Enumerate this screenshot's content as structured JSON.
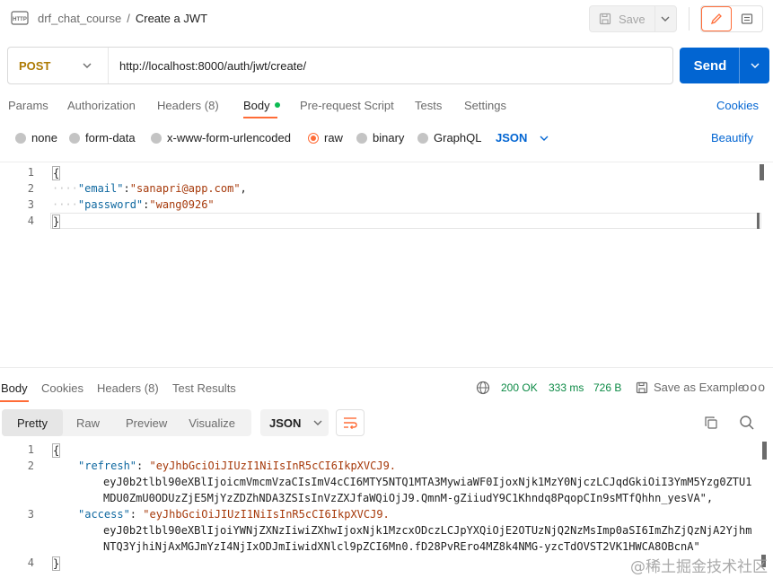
{
  "header": {
    "collection": "drf_chat_course",
    "separator": "/",
    "request_name": "Create a JWT",
    "save_label": "Save"
  },
  "request": {
    "method": "POST",
    "url": "http://localhost:8000/auth/jwt/create/",
    "send_label": "Send"
  },
  "request_tabs": {
    "params": "Params",
    "authorization": "Authorization",
    "headers": "Headers",
    "headers_count": "(8)",
    "body": "Body",
    "pre_request": "Pre-request Script",
    "tests": "Tests",
    "settings": "Settings",
    "cookies": "Cookies"
  },
  "body_types": {
    "none": "none",
    "form_data": "form-data",
    "urlencoded": "x-www-form-urlencoded",
    "raw": "raw",
    "binary": "binary",
    "graphql": "GraphQL",
    "format": "JSON",
    "beautify": "Beautify",
    "selected": "raw"
  },
  "request_body": {
    "line_numbers": [
      "1",
      "2",
      "3",
      "4"
    ],
    "open_brace": "{",
    "close_brace": "}",
    "indent_dots": "····",
    "email_key": "\"email\"",
    "email_value": "\"sanapri@app.com\"",
    "password_key": "\"password\"",
    "password_value": "\"wang0926\""
  },
  "response_tabs": {
    "body": "Body",
    "cookies": "Cookies",
    "headers": "Headers",
    "headers_count": "(8)",
    "test_results": "Test Results",
    "status": "200 OK",
    "time": "333 ms",
    "size": "726 B",
    "save_example": "Save as Example",
    "more": "ooo"
  },
  "response_view": {
    "pretty": "Pretty",
    "raw": "Raw",
    "preview": "Preview",
    "visualize": "Visualize",
    "format": "JSON",
    "selected": "Pretty"
  },
  "response_body": {
    "line_numbers": [
      "1",
      "2",
      "",
      "",
      "3",
      "",
      "",
      "4"
    ],
    "open_brace": "{",
    "close_brace": "}",
    "refresh_key": "\"refresh\"",
    "refresh_part1": "\"eyJhbGciOiJIUzI1NiIsInR5cCI6IkpXVCJ9.",
    "refresh_part2": "eyJ0b2tlbl90eXBlIjoicmVmcmVzaCIsImV4cCI6MTY5NTQ1MTA3MywiaWF0IjoxNjk1MzY0NjczLCJqdGkiOiI3YmM5Yzg0ZTU1",
    "refresh_part3": "MDU0ZmU0ODUzZjE5MjYzZDZhNDA3ZSIsInVzZXJfaWQiOjJ9.QmnM-gZiiudY9C1Khndq8PqopCIn9sMTfQhhn_yesVA\",",
    "access_key": "\"access\"",
    "access_part1": "\"eyJhbGciOiJIUzI1NiIsInR5cCI6IkpXVCJ9.",
    "access_part2": "eyJ0b2tlbl90eXBlIjoiYWNjZXNzIiwiZXhwIjoxNjk1MzcxODczLCJpYXQiOjE2OTUzNjQ2NzMsImp0aSI6ImZhZjQzNjA2Yjhm",
    "access_part3": "NTQ3YjhiNjAxMGJmYzI4NjIxODJmIiwidXNlcl9pZCI6Mn0.fD28PvRErо4MZ8k4NMG-yzcTdOVST2VK1HWCA8OBcnA\""
  },
  "watermark": "@稀土掘金技术社区",
  "colors": {
    "accent": "#ff6c37",
    "primary": "#0265d2",
    "method": "#ad7a03",
    "status": "#0c8a45",
    "json_key": "#0f68a0",
    "json_string": "#a6390a"
  }
}
